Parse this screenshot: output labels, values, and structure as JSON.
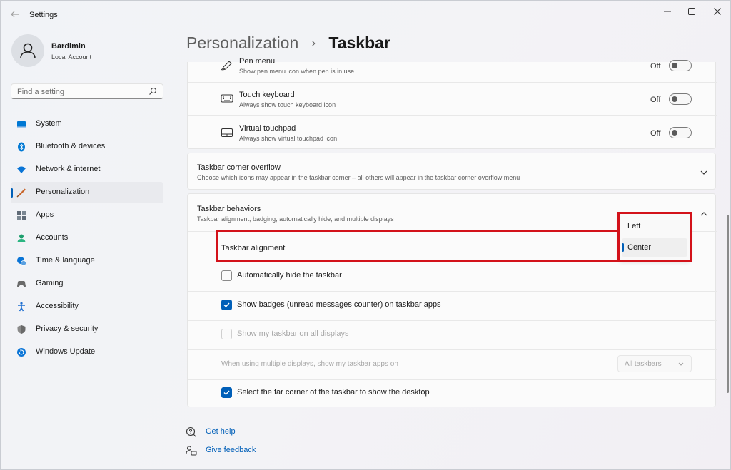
{
  "window": {
    "title": "Settings",
    "controls": [
      "minimize-icon",
      "maximize-icon",
      "close-icon"
    ]
  },
  "profile": {
    "name": "Bardimin",
    "account_type": "Local Account"
  },
  "search": {
    "placeholder": "Find a setting"
  },
  "sidebar": {
    "items": [
      {
        "label": "System",
        "icon": "system-icon",
        "color": "#0078d4"
      },
      {
        "label": "Bluetooth & devices",
        "icon": "bluetooth-icon",
        "color": "#0078d4"
      },
      {
        "label": "Network & internet",
        "icon": "wifi-icon",
        "color": "#0a74d6"
      },
      {
        "label": "Personalization",
        "icon": "brush-icon",
        "color": "#c8652a",
        "active": true
      },
      {
        "label": "Apps",
        "icon": "apps-icon",
        "color": "#5f6a77"
      },
      {
        "label": "Accounts",
        "icon": "accounts-icon",
        "color": "#1f9e6e"
      },
      {
        "label": "Time & language",
        "icon": "globe-clock-icon",
        "color": "#0a74d6"
      },
      {
        "label": "Gaming",
        "icon": "gamepad-icon",
        "color": "#6a6a6a"
      },
      {
        "label": "Accessibility",
        "icon": "accessibility-icon",
        "color": "#1f6fd1"
      },
      {
        "label": "Privacy & security",
        "icon": "shield-icon",
        "color": "#7a7a7a"
      },
      {
        "label": "Windows Update",
        "icon": "update-icon",
        "color": "#0a74d6"
      }
    ]
  },
  "breadcrumb": {
    "parent": "Personalization",
    "separator": "›",
    "current": "Taskbar"
  },
  "corner_icons": [
    {
      "title": "Pen menu",
      "subtitle": "Show pen menu icon when pen is in use",
      "state": "Off",
      "icon": "pen-icon"
    },
    {
      "title": "Touch keyboard",
      "subtitle": "Always show touch keyboard icon",
      "state": "Off",
      "icon": "keyboard-icon"
    },
    {
      "title": "Virtual touchpad",
      "subtitle": "Always show virtual touchpad icon",
      "state": "Off",
      "icon": "touchpad-icon"
    }
  ],
  "corner_overflow": {
    "title": "Taskbar corner overflow",
    "subtitle": "Choose which icons may appear in the taskbar corner – all others will appear in the taskbar corner overflow menu"
  },
  "behaviors": {
    "title": "Taskbar behaviors",
    "subtitle": "Taskbar alignment, badging, automatically hide, and multiple displays",
    "alignment_label": "Taskbar alignment",
    "alignment_options": [
      "Left",
      "Center"
    ],
    "alignment_selected": "Center",
    "auto_hide": {
      "label": "Automatically hide the taskbar",
      "checked": false
    },
    "badges": {
      "label": "Show badges (unread messages counter) on taskbar apps",
      "checked": true
    },
    "all_displays": {
      "label": "Show my taskbar on all displays",
      "checked": false,
      "disabled": true
    },
    "multi_display": {
      "label": "When using multiple displays, show my taskbar apps on",
      "value": "All taskbars",
      "disabled": true
    },
    "far_corner": {
      "label": "Select the far corner of the taskbar to show the desktop",
      "checked": true
    }
  },
  "footer": {
    "help": "Get help",
    "feedback": "Give feedback"
  },
  "colors": {
    "accent": "#005fb8",
    "highlight": "#d3121a"
  }
}
